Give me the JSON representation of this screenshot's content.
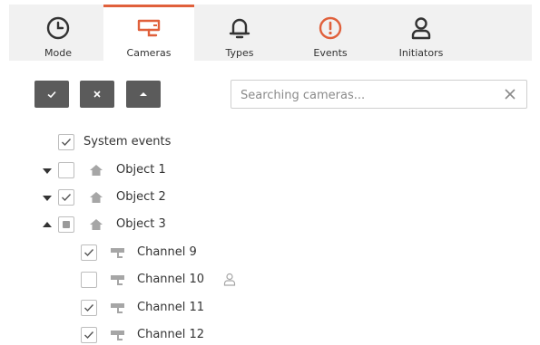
{
  "tabs": [
    {
      "label": "Mode",
      "icon": "clock-icon",
      "active": false
    },
    {
      "label": "Cameras",
      "icon": "camera-icon",
      "active": true
    },
    {
      "label": "Types",
      "icon": "bell-icon",
      "active": false
    },
    {
      "label": "Events",
      "icon": "alert-icon",
      "active": false
    },
    {
      "label": "Initiators",
      "icon": "user-icon",
      "active": false
    }
  ],
  "toolbar": {
    "select_all_icon": "checkmark-icon",
    "clear_icon": "close-icon",
    "collapse_icon": "caret-up-icon"
  },
  "search": {
    "placeholder": "Searching cameras...",
    "value": ""
  },
  "tree": {
    "system_events": {
      "label": "System events",
      "checked": true
    },
    "objects": [
      {
        "label": "Object 1",
        "state": "unchecked",
        "expanded": false
      },
      {
        "label": "Object 2",
        "state": "checked",
        "expanded": false
      },
      {
        "label": "Object 3",
        "state": "partial",
        "expanded": true
      }
    ],
    "channels": [
      {
        "label": "Channel 9",
        "checked": true,
        "has_user_icon": false
      },
      {
        "label": "Channel 10",
        "checked": false,
        "has_user_icon": true
      },
      {
        "label": "Channel 11",
        "checked": true,
        "has_user_icon": false
      },
      {
        "label": "Channel 12",
        "checked": true,
        "has_user_icon": false
      }
    ]
  },
  "colors": {
    "accent": "#e0603b",
    "button_bg": "#5b5b5b",
    "tabbar_bg": "#f1f1f1",
    "icon_gray": "#a6a6a6"
  }
}
